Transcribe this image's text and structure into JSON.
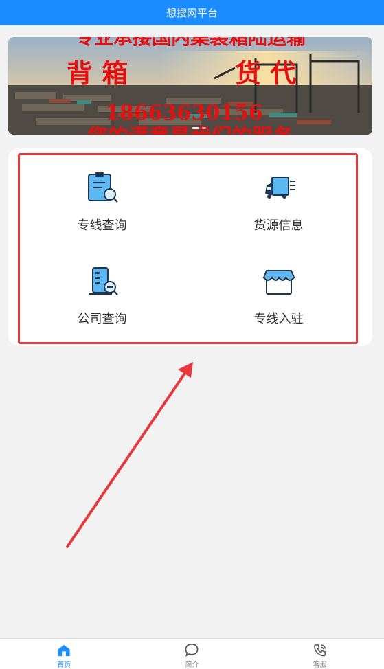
{
  "header": {
    "title": "想搜网平台"
  },
  "banner": {
    "line_top": "专业承接国内集装箱陆运输",
    "tag_left": "背 箱",
    "tag_right": "货 代",
    "phone": "18663630156",
    "line_bottom": "您的满意是我们的服务"
  },
  "menu": {
    "items": [
      {
        "label": "专线查询",
        "icon": "route-search-icon"
      },
      {
        "label": "货源信息",
        "icon": "truck-icon"
      },
      {
        "label": "公司查询",
        "icon": "company-search-icon"
      },
      {
        "label": "专线入驻",
        "icon": "storefront-icon"
      }
    ]
  },
  "tabbar": {
    "items": [
      {
        "label": "首页",
        "icon": "home-icon",
        "active": true
      },
      {
        "label": "简介",
        "icon": "chat-bubble-icon",
        "active": false
      },
      {
        "label": "客服",
        "icon": "phone-icon",
        "active": false
      }
    ]
  },
  "colors": {
    "accent": "#1a8cff",
    "highlight": "#e8383d",
    "icon_blue": "#5bb8f2"
  }
}
